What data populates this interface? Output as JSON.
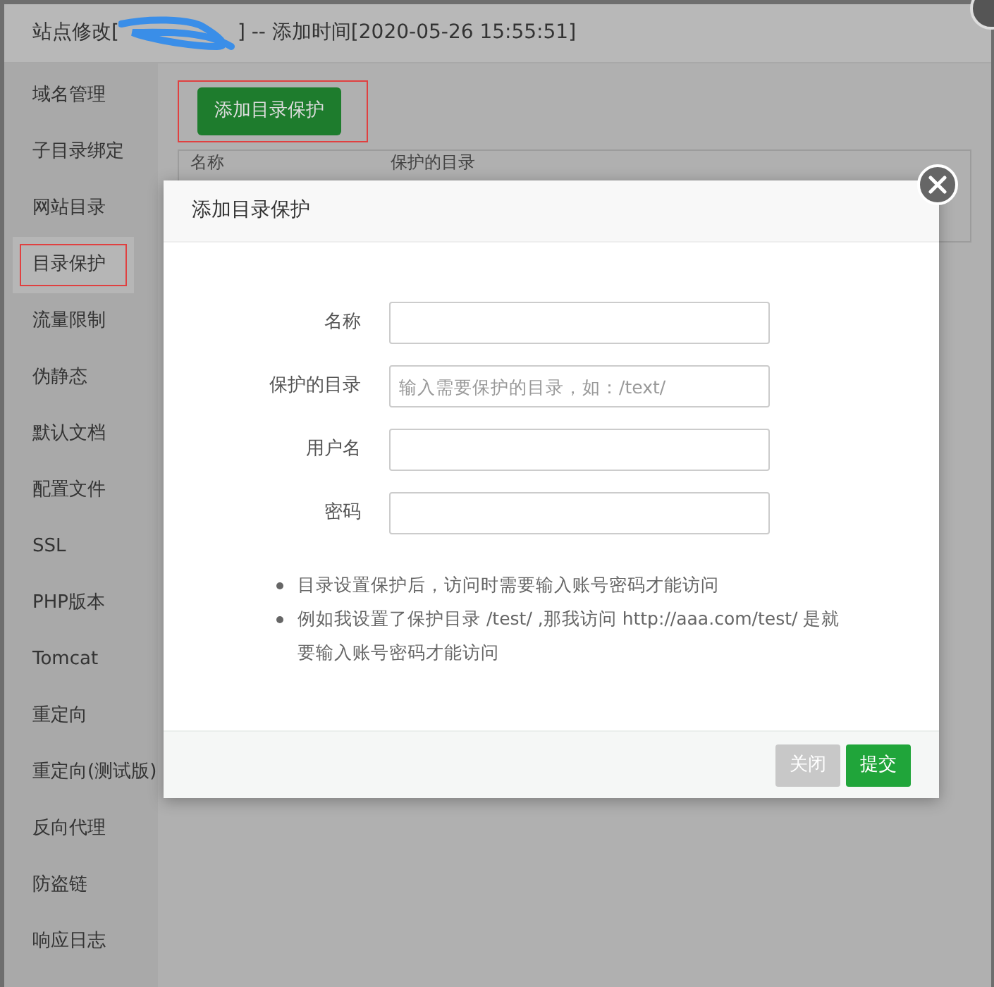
{
  "window": {
    "title_before": "站点修改[",
    "title_after": "] -- 添加时间[2020-05-26 15:55:51]"
  },
  "sidebar": {
    "items": [
      {
        "label": "域名管理",
        "selected": false
      },
      {
        "label": "子目录绑定",
        "selected": false
      },
      {
        "label": "网站目录",
        "selected": false
      },
      {
        "label": "目录保护",
        "selected": true
      },
      {
        "label": "流量限制",
        "selected": false
      },
      {
        "label": "伪静态",
        "selected": false
      },
      {
        "label": "默认文档",
        "selected": false
      },
      {
        "label": "配置文件",
        "selected": false
      },
      {
        "label": "SSL",
        "selected": false
      },
      {
        "label": "PHP版本",
        "selected": false
      },
      {
        "label": "Tomcat",
        "selected": false
      },
      {
        "label": "重定向",
        "selected": false
      },
      {
        "label": "重定向(测试版)",
        "selected": false
      },
      {
        "label": "反向代理",
        "selected": false
      },
      {
        "label": "防盗链",
        "selected": false
      },
      {
        "label": "响应日志",
        "selected": false
      }
    ]
  },
  "toolbar": {
    "add_button": "添加目录保护"
  },
  "table": {
    "columns": [
      "名称",
      "保护的目录"
    ]
  },
  "dialog": {
    "title": "添加目录保护",
    "fields": [
      {
        "label": "名称"
      },
      {
        "label": "保护的目录",
        "placeholder": "输入需要保护的目录，如：/text/"
      },
      {
        "label": "用户名"
      },
      {
        "label": "密码"
      }
    ],
    "notes": [
      "目录设置保护后，访问时需要输入账号密码才能访问",
      "例如我设置了保护目录 /test/ ,那我访问 http://aaa.com/test/ 是就要输入账号密码才能访问"
    ],
    "buttons": [
      {
        "label": "关闭",
        "kind": "secondary"
      },
      {
        "label": "提交",
        "kind": "primary"
      }
    ]
  }
}
